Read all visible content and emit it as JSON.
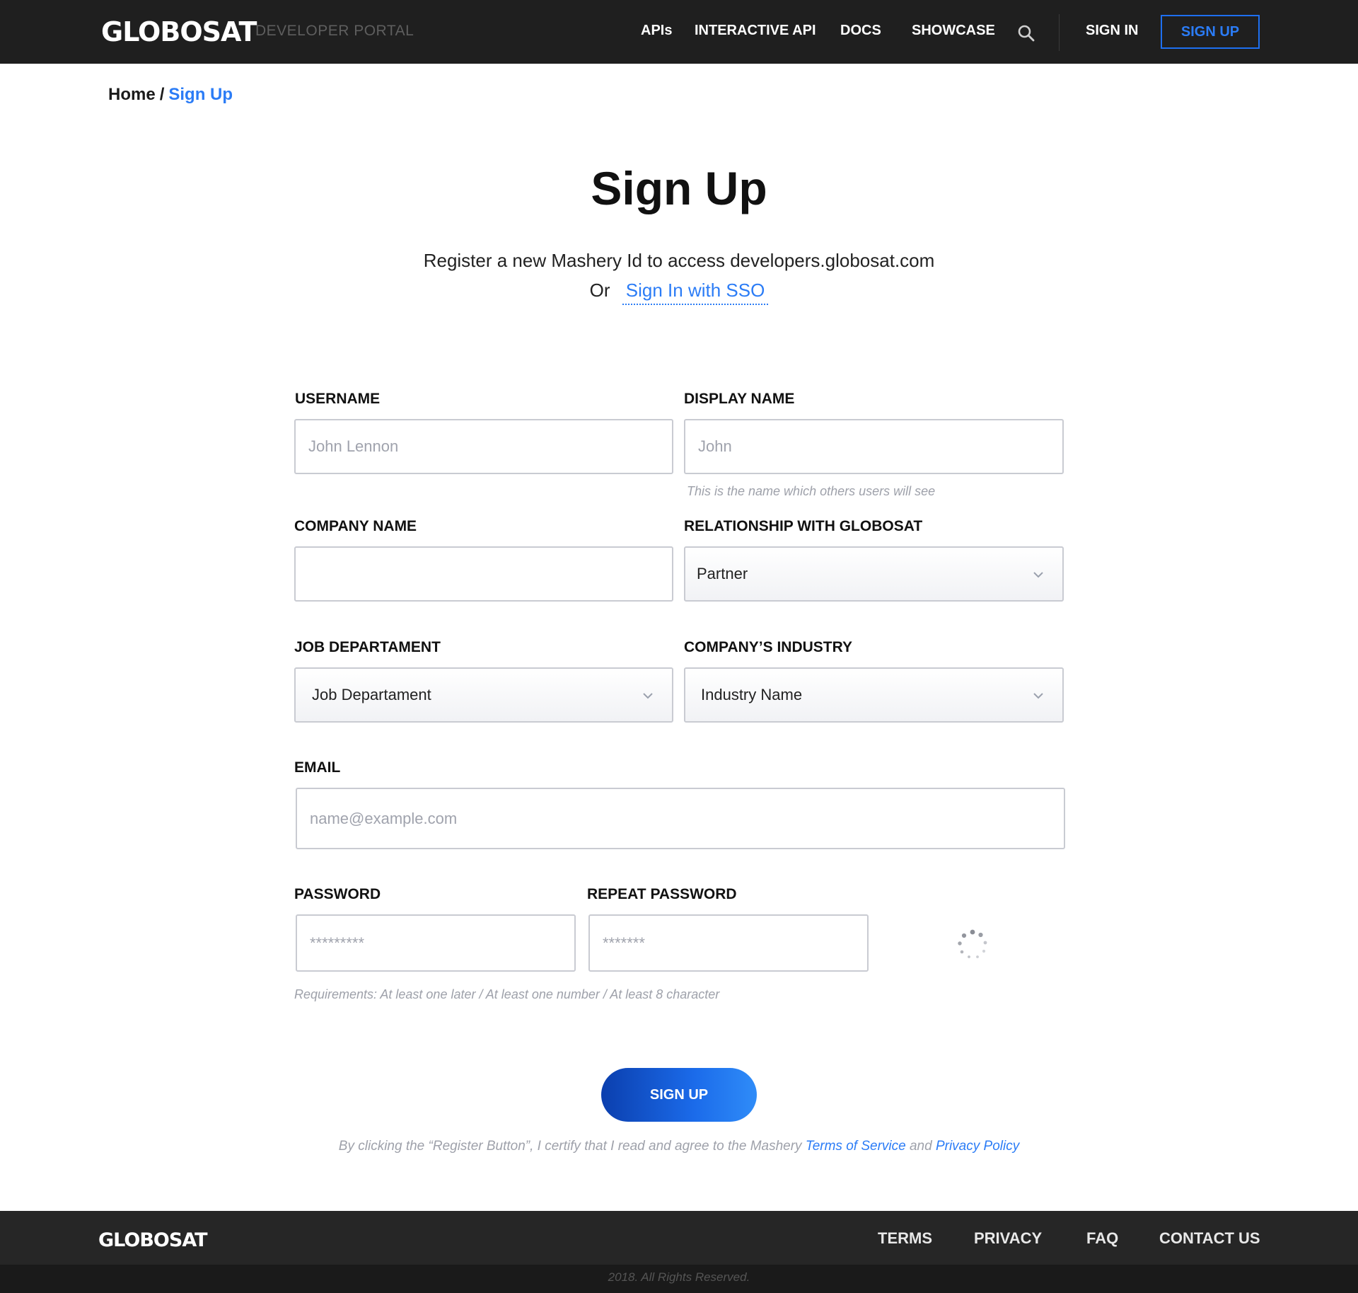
{
  "header": {
    "logo": "GLOBOSAT",
    "logo_sub": "DEVELOPER PORTAL",
    "nav": {
      "apis": "APIs",
      "interactive_api": "INTERACTIVE API",
      "docs": "DOCS",
      "showcase": "SHOWCASE"
    },
    "sign_in": "SIGN IN",
    "sign_up": "SIGN UP"
  },
  "breadcrumb": {
    "home": "Home",
    "separator": "/",
    "current": "Sign Up"
  },
  "page": {
    "title": "Sign Up",
    "subtitle": "Register a new Mashery Id  to access developers.globosat.com",
    "or": "Or",
    "sso_link": "Sign In with SSO"
  },
  "form": {
    "username": {
      "label": "USERNAME",
      "placeholder": "John Lennon"
    },
    "display_name": {
      "label": "DISPLAY NAME",
      "placeholder": "John",
      "hint": "This is the name which others users will see"
    },
    "company_name": {
      "label": "COMPANY NAME",
      "placeholder": ""
    },
    "relationship": {
      "label": "RELATIONSHIP WITH GLOBOSAT",
      "value": "Partner"
    },
    "job_department": {
      "label": "JOB DEPARTAMENT",
      "value": "Job Departament"
    },
    "industry": {
      "label": "COMPANY’S INDUSTRY",
      "value": "Industry Name"
    },
    "email": {
      "label": "EMAIL",
      "placeholder": "name@example.com"
    },
    "password": {
      "label": "PASSWORD",
      "placeholder": "*********"
    },
    "repeat_password": {
      "label": "REPEAT PASSWORD",
      "placeholder": "*******"
    },
    "requirements": "Requirements: At least one later / At least one number / At least 8 character",
    "submit": "SIGN UP",
    "legal_prefix": "By clicking the “Register Button”, I certify that I read and agree to the Mashery",
    "terms_link": "Terms of Service",
    "legal_and": "and",
    "privacy_link": "Privacy Policy"
  },
  "footer": {
    "logo": "GLOBOSAT",
    "links": {
      "terms": "TERMS",
      "privacy": "PRIVACY",
      "faq": "FAQ",
      "contact": "CONTACT US"
    },
    "copyright": "2018. All Rights Reserved."
  },
  "colors": {
    "accent": "#2b7cf6",
    "header_bg": "#1f1f1f",
    "footer_bg": "#262626"
  },
  "icons": {
    "search": "search-icon",
    "chevron": "chevron-down-icon",
    "loading": "loading-spinner-icon"
  }
}
